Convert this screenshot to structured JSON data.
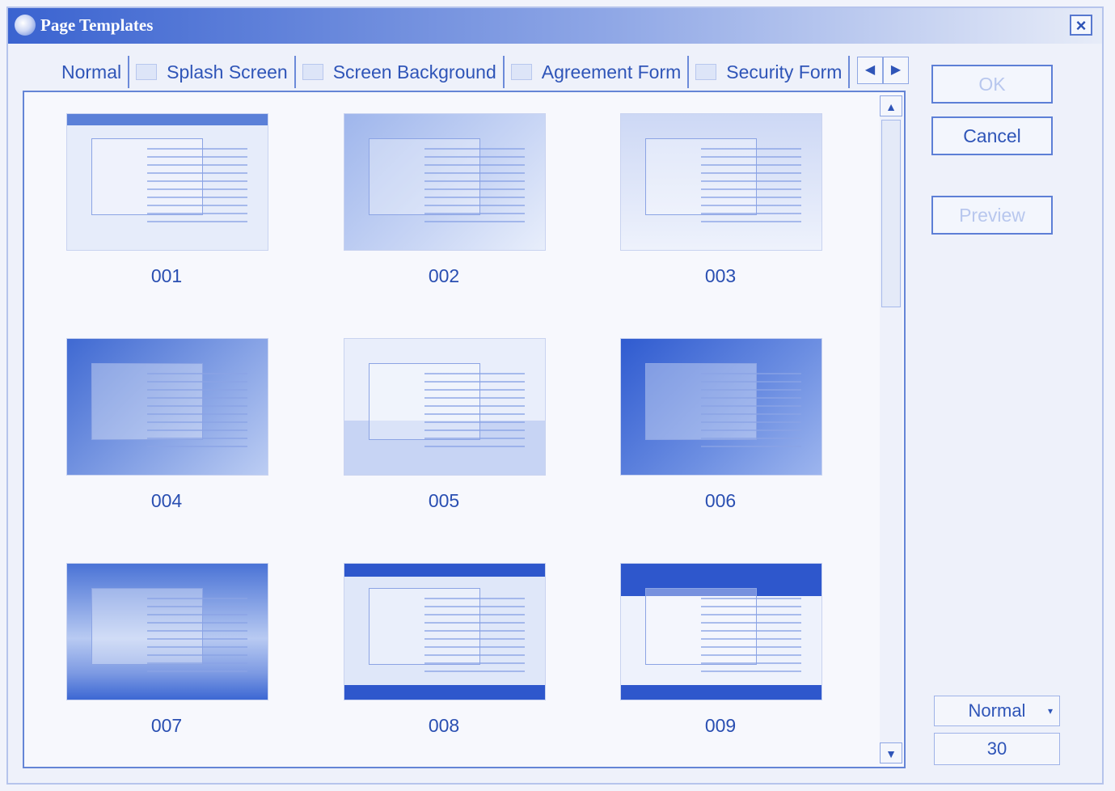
{
  "window": {
    "title": "Page Templates",
    "close_label": "×"
  },
  "tabs": [
    {
      "label": "Normal",
      "icon": "template-icon"
    },
    {
      "label": "Splash Screen",
      "icon": "template-icon"
    },
    {
      "label": "Screen Background",
      "icon": "template-icon"
    },
    {
      "label": "Agreement Form",
      "icon": "template-icon"
    },
    {
      "label": "Security Form",
      "icon": "template-icon"
    }
  ],
  "tab_scroll": {
    "left": "◀",
    "right": "▶"
  },
  "templates": [
    {
      "label": "001"
    },
    {
      "label": "002"
    },
    {
      "label": "003"
    },
    {
      "label": "004"
    },
    {
      "label": "005"
    },
    {
      "label": "006"
    },
    {
      "label": "007"
    },
    {
      "label": "008"
    },
    {
      "label": "009"
    }
  ],
  "scrollbar": {
    "up": "▲",
    "down": "▼"
  },
  "buttons": {
    "ok": "OK",
    "cancel": "Cancel",
    "preview": "Preview"
  },
  "view_mode": {
    "selected": "Normal",
    "caret": "▾"
  },
  "thumbnail_size": "30",
  "colors": {
    "accent": "#2f55b8",
    "titlebar_start": "#3a63d0",
    "panel_border": "#6585d6"
  }
}
